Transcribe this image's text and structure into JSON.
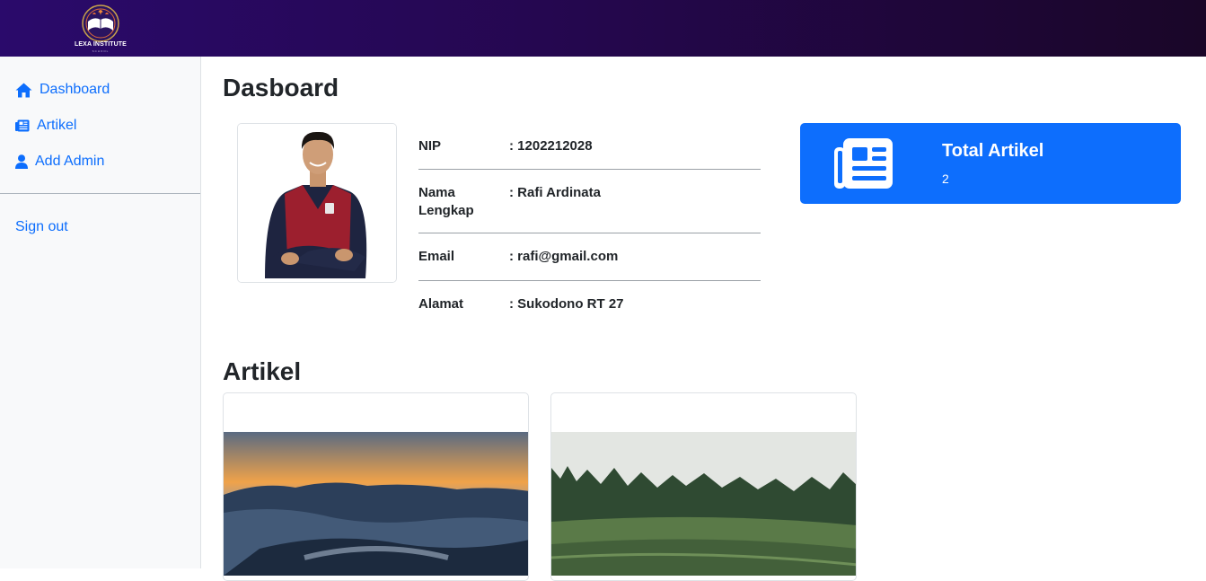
{
  "header": {
    "logo_text": "LEXA INSTITUTE",
    "logo_subtext": "SCHOOL"
  },
  "sidebar": {
    "items": [
      {
        "label": "Dashboard",
        "icon": "home-icon"
      },
      {
        "label": "Artikel",
        "icon": "newspaper-icon"
      },
      {
        "label": "Add Admin",
        "icon": "user-icon"
      }
    ],
    "signout_label": "Sign out"
  },
  "main": {
    "title": "Dasboard",
    "profile": {
      "rows": [
        {
          "label": "NIP",
          "value": ": 1202212028"
        },
        {
          "label": "Nama Lengkap",
          "value": ": Rafi Ardinata"
        },
        {
          "label": "Email",
          "value": ": rafi@gmail.com"
        },
        {
          "label": "Alamat",
          "value": ": Sukodono RT 27"
        }
      ]
    },
    "stat": {
      "title": "Total Artikel",
      "value": "2",
      "icon": "newspaper-icon"
    },
    "articles_title": "Artikel"
  },
  "colors": {
    "accent": "#0d6efd",
    "header_start": "#2a0a6b",
    "header_end": "#1a0628"
  }
}
